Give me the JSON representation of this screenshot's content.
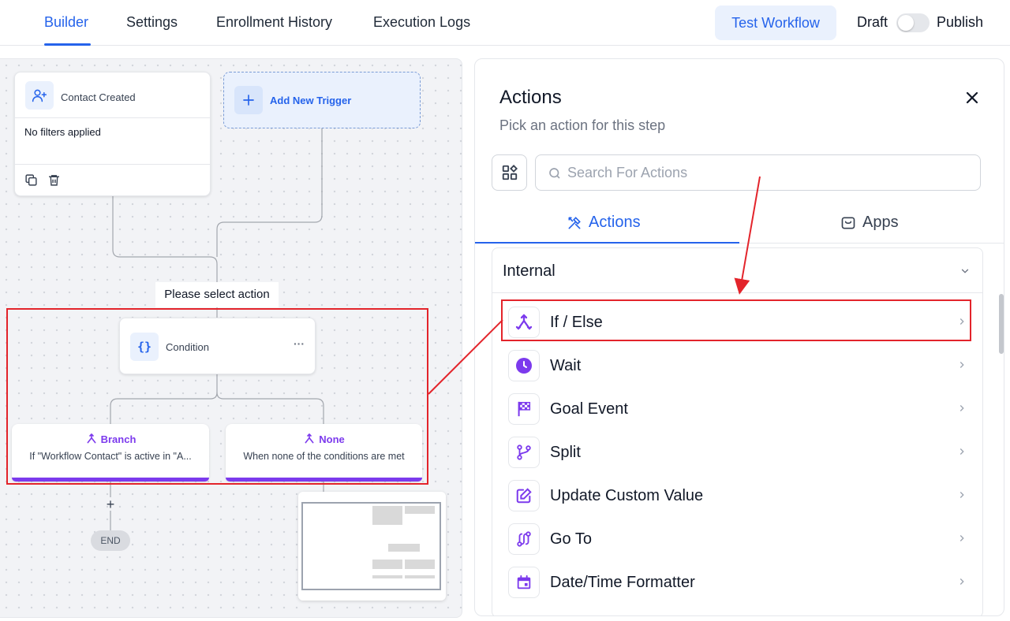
{
  "header": {
    "tabs": [
      "Builder",
      "Settings",
      "Enrollment History",
      "Execution Logs"
    ],
    "active_tab": "Builder",
    "test_button": "Test Workflow",
    "draft_label": "Draft",
    "publish_label": "Publish",
    "toggle_on": false
  },
  "canvas": {
    "trigger": {
      "title": "Contact Created",
      "filters": "No filters applied"
    },
    "add_trigger": "Add New Trigger",
    "select_action_label": "Please select action",
    "condition": {
      "title": "Condition",
      "menu": "···",
      "icon": "{}"
    },
    "branches": [
      {
        "title": "Branch",
        "desc": "If \"Workflow Contact\" is active in \"A..."
      },
      {
        "title": "None",
        "desc": "When none of the conditions are met"
      }
    ],
    "add_symbol": "+",
    "end_label": "END"
  },
  "panel": {
    "title": "Actions",
    "subtitle": "Pick an action for this step",
    "search_placeholder": "Search For Actions",
    "tabs": [
      "Actions",
      "Apps"
    ],
    "active_tab": "Actions",
    "section_title": "Internal",
    "items": [
      {
        "label": "If / Else",
        "icon": "branch-icon"
      },
      {
        "label": "Wait",
        "icon": "clock-icon"
      },
      {
        "label": "Goal Event",
        "icon": "checkered-flag-icon"
      },
      {
        "label": "Split",
        "icon": "split-icon"
      },
      {
        "label": "Update Custom Value",
        "icon": "edit-icon"
      },
      {
        "label": "Go To",
        "icon": "goto-icon"
      },
      {
        "label": "Date/Time Formatter",
        "icon": "calendar-icon"
      }
    ]
  },
  "colors": {
    "accent": "#2563eb",
    "purple": "#7c3aed",
    "annotation": "#e3242b"
  }
}
